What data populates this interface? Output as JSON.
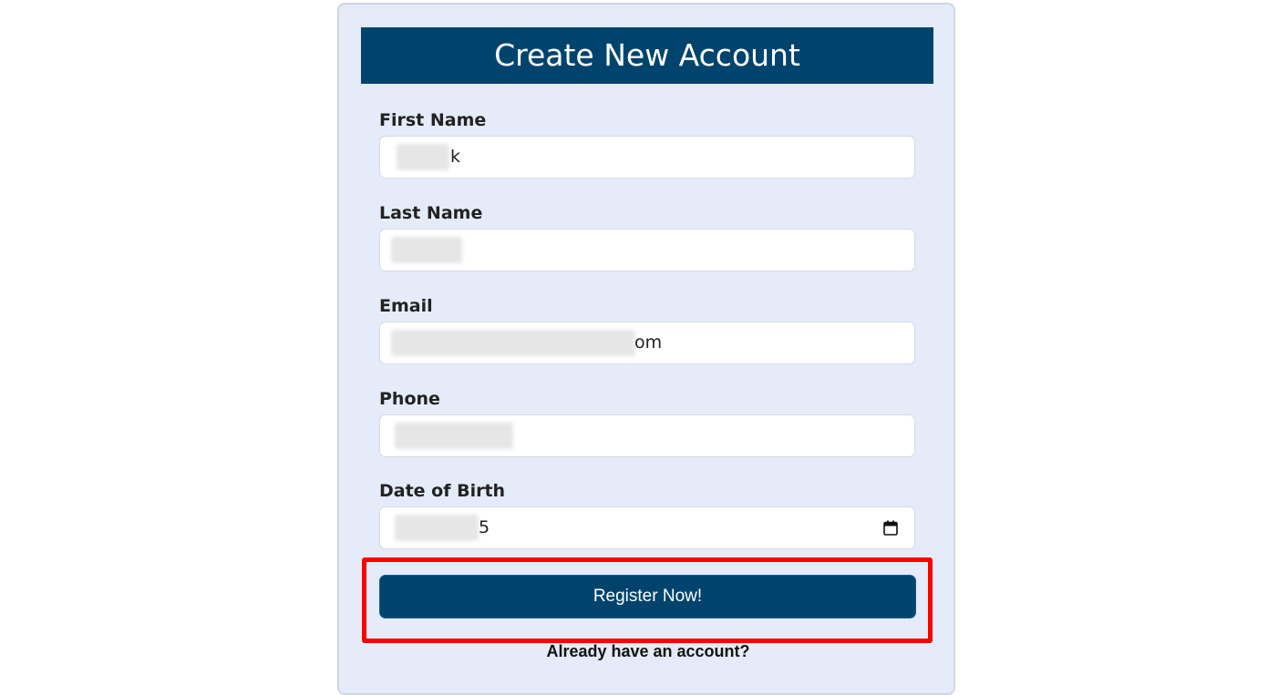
{
  "form": {
    "title": "Create New Account",
    "fields": [
      {
        "label": "First Name",
        "value_visible": "k"
      },
      {
        "label": "Last Name",
        "value_visible": ""
      },
      {
        "label": "Email",
        "value_visible": "om"
      },
      {
        "label": "Phone",
        "value_visible": ""
      },
      {
        "label": "Date of Birth",
        "value_visible": "5"
      }
    ],
    "submit_label": "Register Now!",
    "login_prompt": "Already have an account?"
  },
  "icons": {
    "date_picker": "calendar-icon"
  },
  "colors": {
    "header_bg": "#00446e",
    "card_bg": "#e5ebf8",
    "button_bg": "#00446e",
    "highlight": "#ff0000"
  }
}
